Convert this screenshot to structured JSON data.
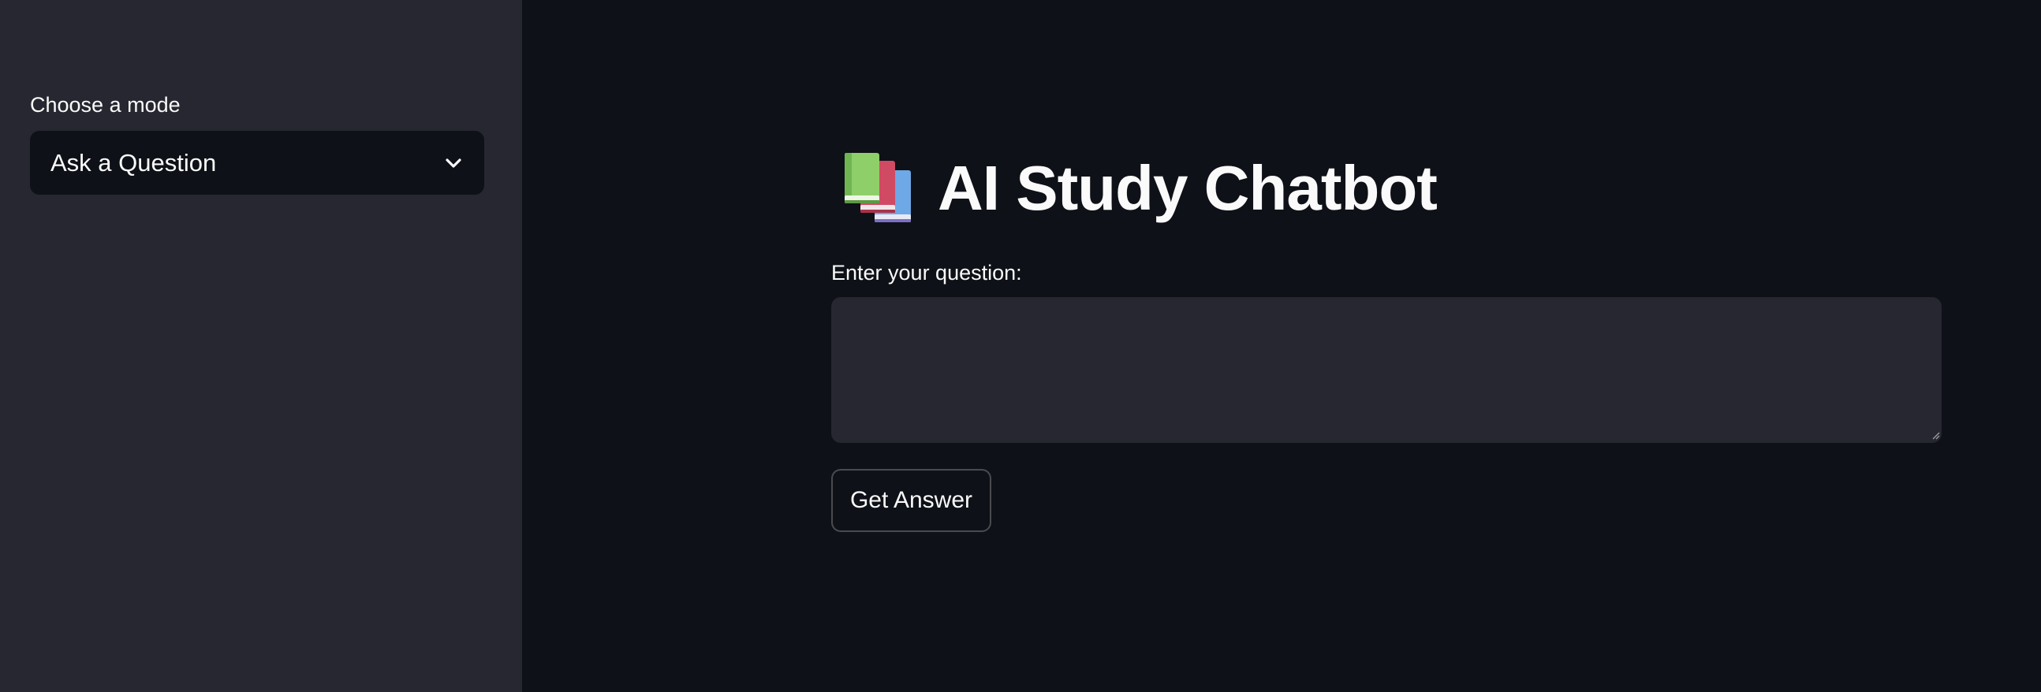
{
  "sidebar": {
    "mode_label": "Choose a mode",
    "select": {
      "value": "Ask a Question",
      "icon": "chevron-down-icon"
    }
  },
  "main": {
    "title_icon": "books-icon",
    "title": "AI Study Chatbot",
    "question_label": "Enter your question:",
    "question_value": "",
    "submit_label": "Get Answer"
  },
  "colors": {
    "sidebar_bg": "#262730",
    "main_bg": "#0e1117",
    "input_bg": "#262730",
    "text": "#fafafa"
  }
}
